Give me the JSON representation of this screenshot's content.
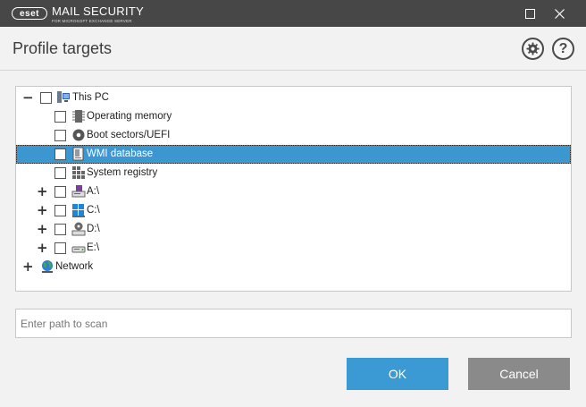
{
  "window": {
    "logo_text": "eset",
    "product_name": "MAIL SECURITY",
    "product_subtitle": "FOR MICROSOFT EXCHANGE SERVER"
  },
  "header": {
    "title": "Profile targets",
    "help_glyph": "?"
  },
  "tree": {
    "nodes": [
      {
        "label": "This PC",
        "expander": "−",
        "icon": "computer-icon"
      },
      {
        "label": "Operating memory",
        "expander": "",
        "icon": "memory-chip-icon"
      },
      {
        "label": "Boot sectors/UEFI",
        "expander": "",
        "icon": "disc-icon"
      },
      {
        "label": "WMI database",
        "expander": "",
        "icon": "wmi-database-icon",
        "selected": true
      },
      {
        "label": "System registry",
        "expander": "",
        "icon": "registry-icon"
      },
      {
        "label": "A:\\",
        "expander": "+",
        "icon": "floppy-drive-icon"
      },
      {
        "label": "C:\\",
        "expander": "+",
        "icon": "windows-drive-icon"
      },
      {
        "label": "D:\\",
        "expander": "+",
        "icon": "optical-drive-icon"
      },
      {
        "label": "E:\\",
        "expander": "+",
        "icon": "removable-drive-icon"
      },
      {
        "label": "Network",
        "expander": "+",
        "icon": "network-globe-icon"
      }
    ]
  },
  "path": {
    "placeholder": "Enter path to scan",
    "value": ""
  },
  "buttons": {
    "ok_label": "OK",
    "cancel_label": "Cancel"
  },
  "colors": {
    "titlebar": "#474747",
    "selection": "#3c97d0",
    "ok_button": "#3b9ad3",
    "cancel_button": "#8a8a8a"
  }
}
